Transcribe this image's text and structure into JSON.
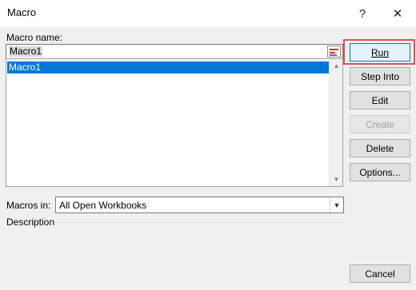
{
  "window": {
    "title": "Macro",
    "help_glyph": "?",
    "close_glyph": "✕"
  },
  "macro_name": {
    "label": "Macro name:",
    "value": "Macro1",
    "items": [
      "Macro1"
    ],
    "selected_index": 0
  },
  "buttons": {
    "run": "Run",
    "step_into": "Step Into",
    "edit": "Edit",
    "create": "Create",
    "delete": "Delete",
    "options": "Options...",
    "cancel": "Cancel"
  },
  "macros_in": {
    "label": "Macros in:",
    "value": "All Open Workbooks"
  },
  "description": {
    "label": "Description",
    "text": ""
  },
  "colors": {
    "selection": "#0078d7",
    "highlight_frame": "#d9534f"
  }
}
